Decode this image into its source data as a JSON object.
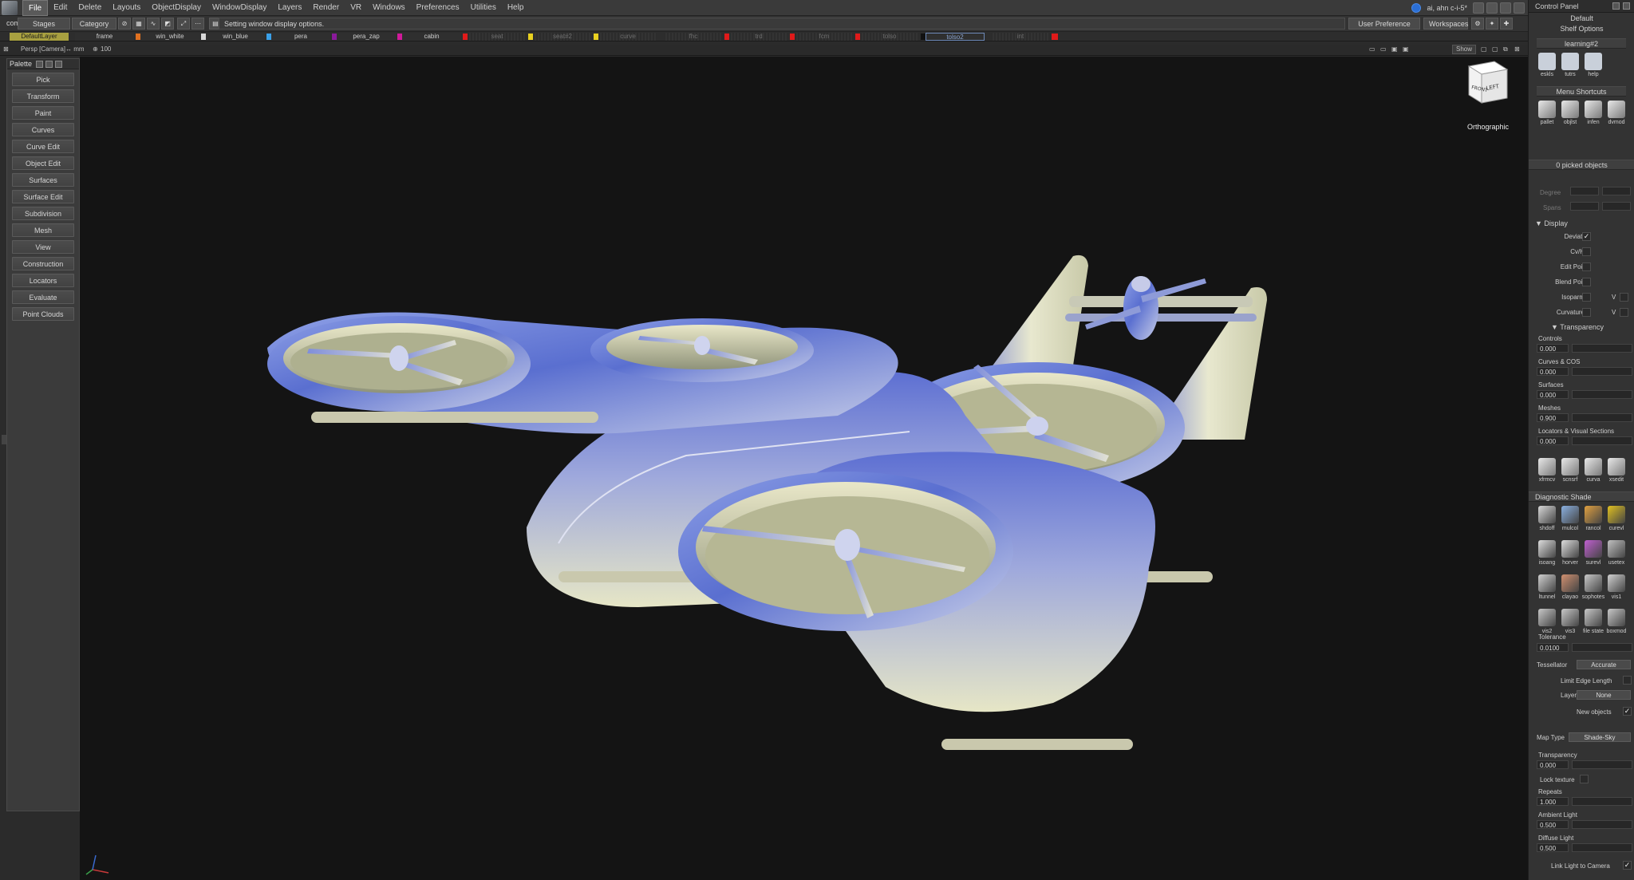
{
  "menubar": {
    "items": [
      "File",
      "Edit",
      "Delete",
      "Layouts",
      "ObjectDisplay",
      "WindowDisplay",
      "Layers",
      "Render",
      "VR",
      "Windows",
      "Preferences",
      "Utilities",
      "Help"
    ],
    "active_index": 0,
    "user": "ai, ahn c-i-5*"
  },
  "toolbar2": {
    "comp_label": "comp",
    "stages_label": "Stages",
    "category_label": "Category",
    "status_text": "Setting window display options.",
    "user_pref_sets": "User Preference Sets",
    "workspaces": "Workspaces"
  },
  "layers": [
    {
      "name": "DefaultLayer",
      "state": "default",
      "swatch": ""
    },
    {
      "name": "frame",
      "state": "normal",
      "swatch": "#e07020"
    },
    {
      "name": "win_white",
      "state": "normal",
      "swatch": "#d8d8d8"
    },
    {
      "name": "win_blue",
      "state": "normal",
      "swatch": "#3aa0e8"
    },
    {
      "name": "pera",
      "state": "normal",
      "swatch": "#8a1a9a"
    },
    {
      "name": "pera_zap",
      "state": "normal",
      "swatch": "#d01a9a"
    },
    {
      "name": "cabin",
      "state": "normal",
      "swatch": "#e01a1a"
    },
    {
      "name": "seat",
      "state": "dim",
      "swatch": "#e8d020"
    },
    {
      "name": "seat#2",
      "state": "dim",
      "swatch": "#e8d020"
    },
    {
      "name": "curve",
      "state": "dim",
      "swatch": ""
    },
    {
      "name": "fhc",
      "state": "dim",
      "swatch": "#e01a1a"
    },
    {
      "name": "trd",
      "state": "dim",
      "swatch": "#e01a1a"
    },
    {
      "name": "fcm",
      "state": "dim",
      "swatch": "#e01a1a"
    },
    {
      "name": "tolso",
      "state": "dim",
      "swatch": "#111111"
    },
    {
      "name": "tolso2",
      "state": "sel",
      "swatch": ""
    },
    {
      "name": "int",
      "state": "dim",
      "swatch": "#e01a1a"
    }
  ],
  "viewheader": {
    "camera": "Persp [Camera]",
    "units": "↔ mm",
    "zoom": "100",
    "show_label": "Show"
  },
  "palette": {
    "title": "Palette",
    "items": [
      "Pick",
      "Transform",
      "Paint",
      "Curves",
      "Curve Edit",
      "Object Edit",
      "Surfaces",
      "Surface Edit",
      "Subdivision",
      "Mesh",
      "View",
      "Construction",
      "Locators",
      "Evaluate",
      "Point Clouds"
    ]
  },
  "viewcube": {
    "front": "FRONT",
    "left": "LEFT",
    "projection": "Orthographic"
  },
  "control_panel": {
    "title": "Control Panel",
    "default_label": "Default",
    "shelf_options": "Shelf Options",
    "shelf_tab": "learning#2",
    "shelf1": [
      {
        "name": "eskls",
        "icon": "eskls-icon",
        "color": "#c9d0da"
      },
      {
        "name": "tutrs",
        "icon": "tutrs-icon",
        "color": "#c9d0da"
      },
      {
        "name": "help",
        "icon": "help-icon",
        "color": "#c9d0da"
      }
    ],
    "menu_shortcuts": "Menu Shortcuts",
    "shelf2": [
      {
        "name": "pallet",
        "icon": "pallet-icon"
      },
      {
        "name": "objlst",
        "icon": "objlst-icon"
      },
      {
        "name": "infen",
        "icon": "info-icon"
      },
      {
        "name": "dvmod",
        "icon": "dvmod-icon"
      }
    ],
    "picked_objects": "0 picked objects",
    "degree_label": "Degree",
    "spans_label": "Spans",
    "display_section": "Display",
    "display_items": [
      {
        "label": "Deviation",
        "checked": true
      },
      {
        "label": "Cv/Hull",
        "checked": false
      },
      {
        "label": "Edit Points",
        "checked": false
      },
      {
        "label": "Blend Points",
        "checked": false
      },
      {
        "label": "Isoparm U",
        "checked": false,
        "v": "V"
      },
      {
        "label": "Curvature U",
        "checked": false,
        "v": "V"
      }
    ],
    "transparency_section": "Transparency",
    "transparency": [
      {
        "label": "Controls",
        "value": "0.000"
      },
      {
        "label": "Curves & COS",
        "value": "0.000"
      },
      {
        "label": "Surfaces",
        "value": "0.000"
      },
      {
        "label": "Meshes",
        "value": "0.900"
      },
      {
        "label": "Locators & Visual Sections",
        "value": "0.000"
      }
    ],
    "shelf3": [
      {
        "name": "xfrmcv",
        "icon": "xfrmcv-icon"
      },
      {
        "name": "scnsrf",
        "icon": "scnsrf-icon"
      },
      {
        "name": "curva",
        "icon": "curva-icon"
      },
      {
        "name": "xsedit",
        "icon": "xsedit-icon"
      }
    ],
    "diagnostic_shade": "Diagnostic Shade",
    "diag_icons": [
      {
        "name": "shdoff",
        "color": "#d8d8d8"
      },
      {
        "name": "mulcol",
        "color": "#8ab0e0"
      },
      {
        "name": "rancol",
        "color": "#e0a040"
      },
      {
        "name": "curevl",
        "color": "#e0c020"
      },
      {
        "name": "isoang",
        "color": "#dddddd"
      },
      {
        "name": "horver",
        "color": "#dddddd"
      },
      {
        "name": "surevl",
        "color": "#c060d0"
      },
      {
        "name": "usetex",
        "color": "#c0c0c0"
      },
      {
        "name": "ltunnel",
        "color": "#d0d0d0"
      },
      {
        "name": "clayao",
        "color": "#d09070"
      },
      {
        "name": "sophotes",
        "color": "#c8c8c8"
      },
      {
        "name": "vis1",
        "color": "#d0d0d0"
      },
      {
        "name": "vis2",
        "color": "#c8c8c8"
      },
      {
        "name": "vis3",
        "color": "#c8c8c8"
      },
      {
        "name": "file state",
        "color": "#c8c8c8"
      },
      {
        "name": "boxmod",
        "color": "#c8c8c8"
      }
    ],
    "tolerance_label": "Tolerance",
    "tolerance_value": "0.0100",
    "tessellator_label": "Tessellator",
    "tessellator_value": "Accurate",
    "limit_edge_label": "Limit Edge Length",
    "layer_label": "Layer",
    "layer_value": "None",
    "new_objects_label": "New objects",
    "map_type_label": "Map Type",
    "map_type_value": "Shade-Sky",
    "transparency_label": "Transparency",
    "transparency_value": "0.000",
    "lock_texture_label": "Lock texture",
    "repeats_label": "Repeats",
    "repeats_value": "1.000",
    "ambient_label": "Ambient Light",
    "ambient_value": "0.500",
    "diffuse_label": "Diffuse Light",
    "diffuse_value": "0.500",
    "link_light_label": "Link Light to Camera"
  }
}
